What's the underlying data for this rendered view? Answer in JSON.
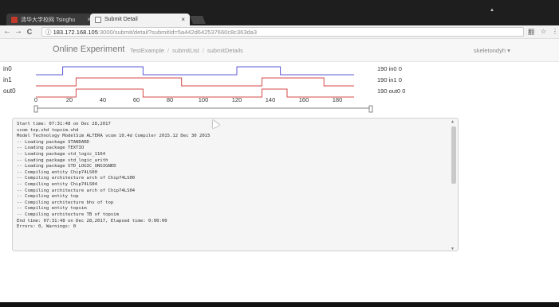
{
  "browser": {
    "tabs": [
      {
        "title": "清华大学校网 Tsinghu",
        "close": "×"
      },
      {
        "title": "Submit Detail",
        "close": "×"
      }
    ],
    "url_host": "183.172.168.105",
    "url_path": ":3000/submit/detail?submitId=5a442d642537660c8c363da3",
    "back": "←",
    "forward": "→",
    "reload": "C",
    "info": "ⓘ",
    "star": "☆",
    "menu": "⋮",
    "translate": "翻"
  },
  "nav": {
    "brand": "Online Experiment",
    "breadcrumbs": [
      "TestExample",
      "submitList",
      "submitDetails"
    ],
    "user": "skeletondyh ▾"
  },
  "waveform": {
    "signals": [
      {
        "name": "in0",
        "value": "190 in0 0",
        "color": "#5b5bd6",
        "transitions": [
          [
            0,
            0
          ],
          [
            16,
            1
          ],
          [
            64,
            0
          ],
          [
            120,
            1
          ],
          [
            135,
            1
          ],
          [
            146,
            0
          ],
          [
            190,
            0
          ]
        ]
      },
      {
        "name": "in1",
        "value": "190 in1 0",
        "color": "#d64a4a",
        "transitions": [
          [
            0,
            0
          ],
          [
            24,
            1
          ],
          [
            64,
            1
          ],
          [
            87,
            0
          ],
          [
            135,
            1
          ],
          [
            172,
            0
          ],
          [
            190,
            0
          ]
        ]
      },
      {
        "name": "out0",
        "value": "190 out0 0",
        "color": "#d64a4a",
        "transitions": [
          [
            0,
            0
          ],
          [
            24,
            1
          ],
          [
            64,
            0
          ],
          [
            135,
            1
          ],
          [
            150,
            0
          ],
          [
            190,
            0
          ]
        ]
      }
    ],
    "axis": {
      "min": 0,
      "max": 200,
      "ticks": [
        "0",
        "20",
        "40",
        "60",
        "80",
        "100",
        "120",
        "140",
        "160",
        "180"
      ]
    }
  },
  "log": {
    "lines": [
      "Start time: 07:31:48 on Dec 28,2017",
      "vcom top.vhd topsim.vhd",
      "Model Technology ModelSim ALTERA vcom 10.4d Compiler 2015.12 Dec 30 2015",
      "-- Loading package STANDARD",
      "-- Loading package TEXTIO",
      "-- Loading package std_logic_1164",
      "-- Loading package std_logic_arith",
      "-- Loading package STD_LOGIC_UNSIGNED",
      "-- Compiling entity Chip74LS00",
      "-- Compiling architecture arch of Chip74LS00",
      "-- Compiling entity Chip74LS04",
      "-- Compiling architecture arch of Chip74LS04",
      "-- Compiling entity top",
      "-- Compiling architecture bhv of top",
      "-- Compiling entity topsim",
      "-- Compiling architecture TB of topsim",
      "End time: 07:31:48 on Dec 28,2017, Elapsed time: 0:00:00",
      "Errors: 0, Warnings: 0"
    ]
  }
}
